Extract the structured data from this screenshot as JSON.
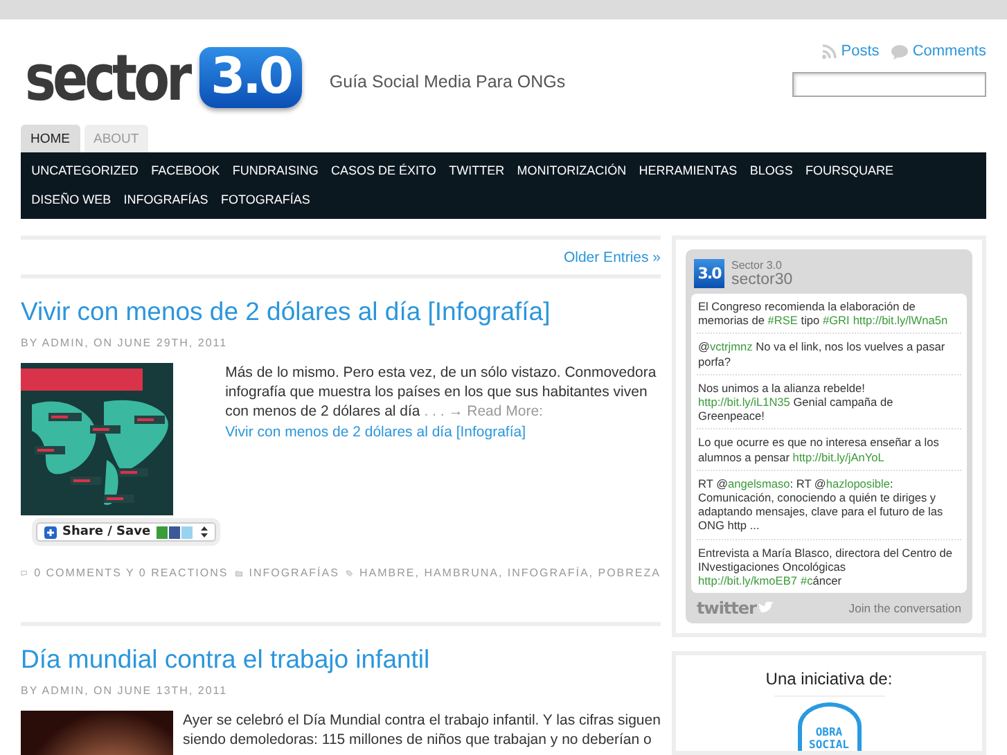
{
  "header": {
    "logo": {
      "word": "sector",
      "badge": "3.0"
    },
    "tagline": "Guía Social Media Para ONGs",
    "feed_links": [
      {
        "label": "Posts",
        "kind": "rss"
      },
      {
        "label": "Comments",
        "kind": "comments"
      }
    ]
  },
  "page_tabs": [
    {
      "label": "HOME",
      "selected": true
    },
    {
      "label": "ABOUT",
      "selected": false
    }
  ],
  "categories": [
    "UNCATEGORIZED",
    "FACEBOOK",
    "FUNDRAISING",
    "CASOS DE ÉXITO",
    "TWITTER",
    "MONITORIZACIÓN",
    "HERRAMIENTAS",
    "BLOGS",
    "FOURSQUARE",
    "DISEÑO WEB",
    "INFOGRAFÍAS",
    "FOTOGRAFÍAS"
  ],
  "pagination": {
    "older": "Older Entries »"
  },
  "posts": [
    {
      "title": "Vivir con menos de 2 dólares al día [Infografía]",
      "byline": "BY ADMIN, ON JUNE 29TH, 2011",
      "kind": "infographic",
      "excerpt": "Más de lo mismo. Pero esta vez, de un sólo vistazo. Conmovedora infografía que muestra los países en los que sus habitantes viven con menos de 2 dólares al día",
      "ellipsis": " . . .",
      "read_more": "→ Read More:",
      "read_more_link": "Vivir con menos de 2 dólares al día [Infografía]",
      "share": "Share / Save",
      "comments": "0 COMMENTS Y 0 REACTIONS",
      "category": "INFOGRAFÍAS",
      "tags": "HAMBRE, HAMBRUNA, INFOGRAFÍA, POBREZA"
    },
    {
      "title": "Día mundial contra el trabajo infantil",
      "byline": "BY ADMIN, ON JUNE 13TH, 2011",
      "kind": "photo",
      "excerpt": "Ayer se celebró el Día Mundial contra el trabajo infantil. Y las cifras siguen siendo demoledoras: 115 millones de niños que trabajan y no deberían o"
    }
  ],
  "twitter_widget": {
    "avatar": "3.0",
    "account_name": "Sector 3.0",
    "handle": "sector30",
    "tweets": [
      [
        {
          "kind": "text",
          "t": "El Congreso recomienda la elaboración de memorias de "
        },
        {
          "kind": "link",
          "t": "#RSE"
        },
        {
          "kind": "text",
          "t": " tipo "
        },
        {
          "kind": "link",
          "t": "#GRI"
        },
        {
          "kind": "link",
          "t": "http://bit.ly/lWna5n"
        }
      ],
      [
        {
          "kind": "text",
          "t": "@"
        },
        {
          "kind": "link",
          "t": "vctrjmnz"
        },
        {
          "kind": "text",
          "t": " No va el link, nos los vuelves a pasar porfa?"
        }
      ],
      [
        {
          "kind": "text",
          "t": "Nos unimos a la alianza rebelde! "
        },
        {
          "kind": "link",
          "t": "http://bit.ly/iL1N35"
        },
        {
          "kind": "text",
          "t": " Genial campaña de Greenpeace!"
        }
      ],
      [
        {
          "kind": "text",
          "t": "Lo que ocurre es que no interesa enseñar a los alumnos a pensar "
        },
        {
          "kind": "link",
          "t": "http://bit.ly/jAnYoL"
        }
      ],
      [
        {
          "kind": "text",
          "t": "RT @"
        },
        {
          "kind": "link",
          "t": "angelsmaso"
        },
        {
          "kind": "text",
          "t": ": RT @"
        },
        {
          "kind": "link",
          "t": "hazloposible"
        },
        {
          "kind": "text",
          "t": ": Comunicación, conociendo a quién te diriges y adaptando mensajes, clave para el futuro de las ONG http ..."
        }
      ],
      [
        {
          "kind": "text",
          "t": "Entrevista a María Blasco, directora del Centro de INvestigaciones Oncológicas "
        },
        {
          "kind": "link",
          "t": "http://bit.ly/kmoEB7"
        },
        {
          "kind": "link",
          "t": "#c"
        },
        {
          "kind": "text",
          "t": "áncer"
        }
      ]
    ],
    "brand": "twitter",
    "footer_link": "Join the conversation"
  },
  "sponsor": {
    "heading": "Una iniciativa de:",
    "stamp": [
      "OBRA",
      "SOCIAL"
    ]
  }
}
